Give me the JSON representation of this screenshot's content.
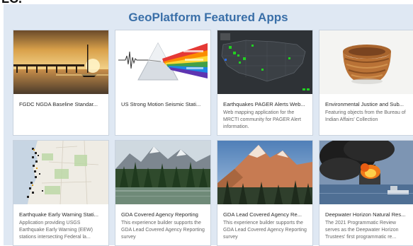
{
  "page": {
    "title": "GeoPlatform Featured Apps",
    "top_fragment": "LC."
  },
  "cards": [
    {
      "title": "FGDC NGDA Baseline Standar...",
      "description": "",
      "image": "bridge-sunset"
    },
    {
      "title": "US Strong Motion Seismic Stati...",
      "description": "",
      "image": "prism-seismograph"
    },
    {
      "title": "Earthquakes PAGER Alerts Web...",
      "description": "Web mapping application for the MRCTI community for PAGER Alert information.",
      "image": "dark-us-map"
    },
    {
      "title": "Environmental Justice and Sub...",
      "description": "Featuring objects from the Bureau of Indian Affairs' Collection",
      "image": "woven-basket"
    },
    {
      "title": "Earthquake Early Warning Stati...",
      "description": "Application providing USGS Earthquake Early Warning (EEW) stations intersecting Federal la...",
      "image": "west-coast-map"
    },
    {
      "title": "GDA Covered Agency Reporting",
      "description": "This experience builder supports the GDA Lead Covered Agency Reporting survey",
      "image": "mountain-lake"
    },
    {
      "title": "GDA Lead Covered Agency Re...",
      "description": "This experience builder supports the GDA Lead Covered Agency Reporting survey",
      "image": "mountain-peak"
    },
    {
      "title": "Deepwater Horizon Natural Res...",
      "description": "The 2021 Programmatic Review serves as the Deepwater Horizon Trustees' first programmatic re...",
      "image": "oil-rig-fire"
    }
  ]
}
